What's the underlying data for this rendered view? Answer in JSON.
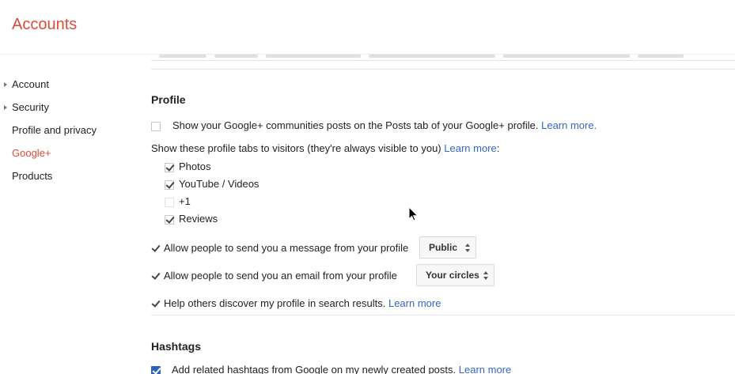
{
  "header": {
    "title": "Accounts"
  },
  "sidebar": {
    "items": [
      {
        "label": "Account",
        "has_arrow": true
      },
      {
        "label": "Security",
        "has_arrow": true
      },
      {
        "label": "Profile and privacy",
        "has_arrow": false
      },
      {
        "label": "Google+",
        "has_arrow": false,
        "active": true
      },
      {
        "label": "Products",
        "has_arrow": false
      }
    ]
  },
  "profile": {
    "title": "Profile",
    "communities": {
      "checked": false,
      "text": "Show your Google+ communities posts on the Posts tab of your Google+ profile.",
      "link": "Learn more."
    },
    "tabs_intro": {
      "text": "Show these profile tabs to visitors (they're always visible to you)",
      "link": "Learn more",
      "suffix": ":"
    },
    "tabs": [
      {
        "label": "Photos",
        "checked": true
      },
      {
        "label": "YouTube / Videos",
        "checked": true
      },
      {
        "label": "+1",
        "checked": false
      },
      {
        "label": "Reviews",
        "checked": true
      }
    ],
    "message": {
      "checked": true,
      "text": "Allow people to send you a message from your profile",
      "select": "Public"
    },
    "email": {
      "checked": true,
      "text": "Allow people to send you an email from your profile",
      "select": "Your circles"
    },
    "search": {
      "checked": true,
      "text": "Help others discover my profile in search results.",
      "link": "Learn more"
    }
  },
  "hashtags": {
    "title": "Hashtags",
    "related": {
      "checked": true,
      "text": "Add related hashtags from Google on my newly created posts.",
      "link": "Learn more"
    }
  },
  "colors": {
    "accent": "#dd4b39",
    "link": "#3366cc",
    "text": "#222222"
  },
  "icons": {
    "cursor": "mouse-pointer-icon",
    "nav": "triangle-right-icon",
    "select": "up-down-arrows-icon"
  }
}
